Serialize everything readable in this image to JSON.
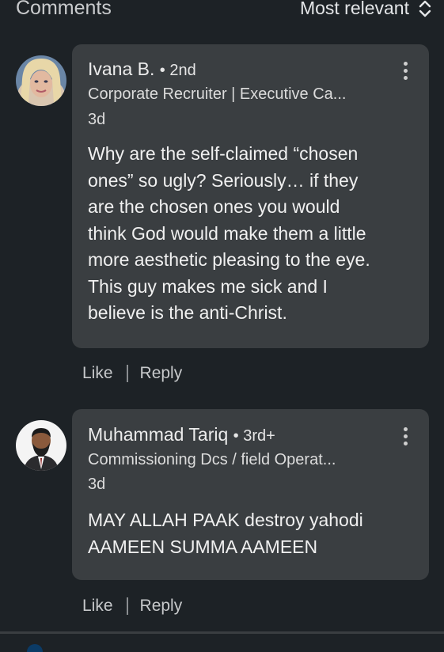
{
  "header": {
    "title": "Comments",
    "sort_label": "Most relevant",
    "sort_icon": "chevron-up-down-icon"
  },
  "comments": [
    {
      "author": "Ivana B.",
      "degree": "• 2nd",
      "headline": "Corporate Recruiter | Executive Ca...",
      "time": "3d",
      "text_lines": [
        "Why are the self-claimed “chosen",
        "ones” so ugly? Seriously… if they",
        "are the chosen ones you would",
        "think God would make them a little",
        "more aesthetic pleasing to the eye.",
        "This guy makes me sick and I",
        "believe is the anti-Christ."
      ],
      "like_label": "Like",
      "reply_label": "Reply"
    },
    {
      "author": "Muhammad Tariq",
      "degree": "• 3rd+",
      "headline": "Commissioning Dcs / field Operat...",
      "time": "3d",
      "text_lines": [
        "MAY ALLAH PAAK destroy yahodi",
        "AAMEEN SUMMA AAMEEN"
      ],
      "like_label": "Like",
      "reply_label": "Reply"
    }
  ],
  "colors": {
    "background": "#1d2226",
    "bubble": "#3a3e41"
  }
}
